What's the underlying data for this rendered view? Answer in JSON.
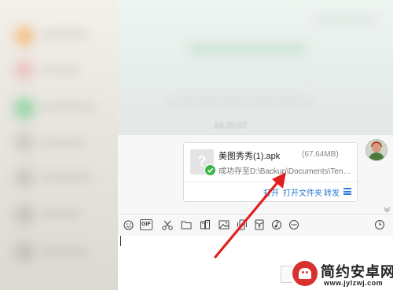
{
  "chat": {
    "timestamp": "10:20:07"
  },
  "file_card": {
    "name": "美图秀秀(1).apk",
    "size": "(67.64MB)",
    "status": "成功存至D:\\Backup\\Documents\\Tence...",
    "actions": {
      "open": "打开",
      "open_folder": "打开文件夹",
      "forward": "转发"
    }
  },
  "toolbar": {
    "gif_label": "GIF"
  },
  "watermark": {
    "title": "简约安卓网",
    "url": "www.jylzwj.com"
  },
  "colors": {
    "accent": "#2b7bd6",
    "arrow": "#e02020",
    "success": "#39b54a",
    "watermark_logo": "#d8312f"
  }
}
